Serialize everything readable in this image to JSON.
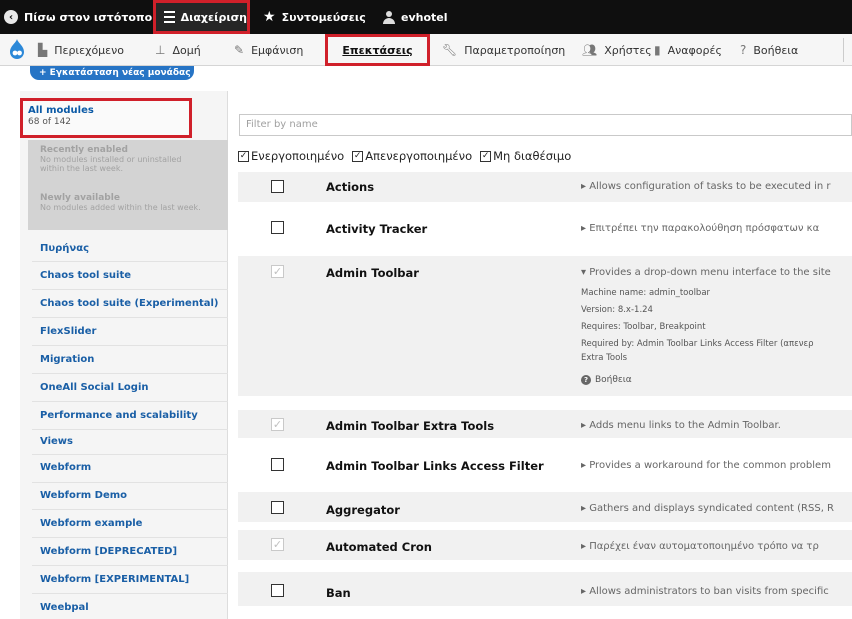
{
  "toolbar": {
    "back": "Πίσω στον ιστότοπο",
    "admin": "Διαχείριση",
    "shortcuts": "Συντομεύσεις",
    "user": "evhotel"
  },
  "tray": {
    "content": "Περιεχόμενο",
    "structure": "Δομή",
    "appearance": "Εμφάνιση",
    "extend": "Επεκτάσεις",
    "config": "Παραμετροποίηση",
    "people": "Χρήστες",
    "reports": "Αναφορές",
    "help": "Βοήθεια"
  },
  "install_button": "+ Εγκατάσταση νέας μονάδας",
  "sidebar": {
    "all_modules": "All modules",
    "all_count": "68 of 142",
    "recently_enabled": "Recently enabled",
    "recently_enabled_desc_1": "No modules installed or uninstalled",
    "recently_enabled_desc_2": "within the last week.",
    "newly_available": "Newly available",
    "newly_available_desc": "No modules added within the last week.",
    "packages": [
      "Πυρήνας",
      "Chaos tool suite",
      "Chaos tool suite (Experimental)",
      "FlexSlider",
      "Migration",
      "OneAll Social Login",
      "Performance and scalability",
      "Views",
      "Webform",
      "Webform Demo",
      "Webform example",
      "Webform [DEPRECATED]",
      "Webform [EXPERIMENTAL]",
      "Weebpal"
    ]
  },
  "filter": {
    "placeholder": "Filter by name"
  },
  "status_filters": [
    "Ενεργοποιημένο",
    "Απενεργοποιημένο",
    "Μη διαθέσιμο"
  ],
  "modules": [
    {
      "name": "Actions",
      "description": "▸ Allows configuration of tasks to be executed in r",
      "enabled": false
    },
    {
      "name": "Activity Tracker",
      "description": "▸ Επιτρέπει την παρακολούθηση πρόσφατων κα",
      "enabled": false
    },
    {
      "name": "Admin Toolbar",
      "description": "▾ Provides a drop-down menu interface to the site",
      "enabled": true,
      "details": [
        "Machine name: admin_toolbar",
        "Version: 8.x-1.24",
        "Requires: Toolbar, Breakpoint",
        "Required by: Admin Toolbar Links Access Filter (απενερ",
        "Extra Tools"
      ],
      "help": "Βοήθεια"
    },
    {
      "name": "Admin Toolbar Extra Tools",
      "description": "▸ Adds menu links to the Admin Toolbar.",
      "enabled": true
    },
    {
      "name": "Admin Toolbar Links Access Filter",
      "description": "▸ Provides a workaround for the common problem",
      "enabled": false
    },
    {
      "name": "Aggregator",
      "description": "▸ Gathers and displays syndicated content (RSS, R",
      "enabled": false
    },
    {
      "name": "Automated Cron",
      "description": "▸ Παρέχει έναν αυτοματοποιημένο τρόπο να τρ",
      "enabled": true
    },
    {
      "name": "Ban",
      "description": "▸ Allows administrators to ban visits from specific",
      "enabled": false
    }
  ]
}
